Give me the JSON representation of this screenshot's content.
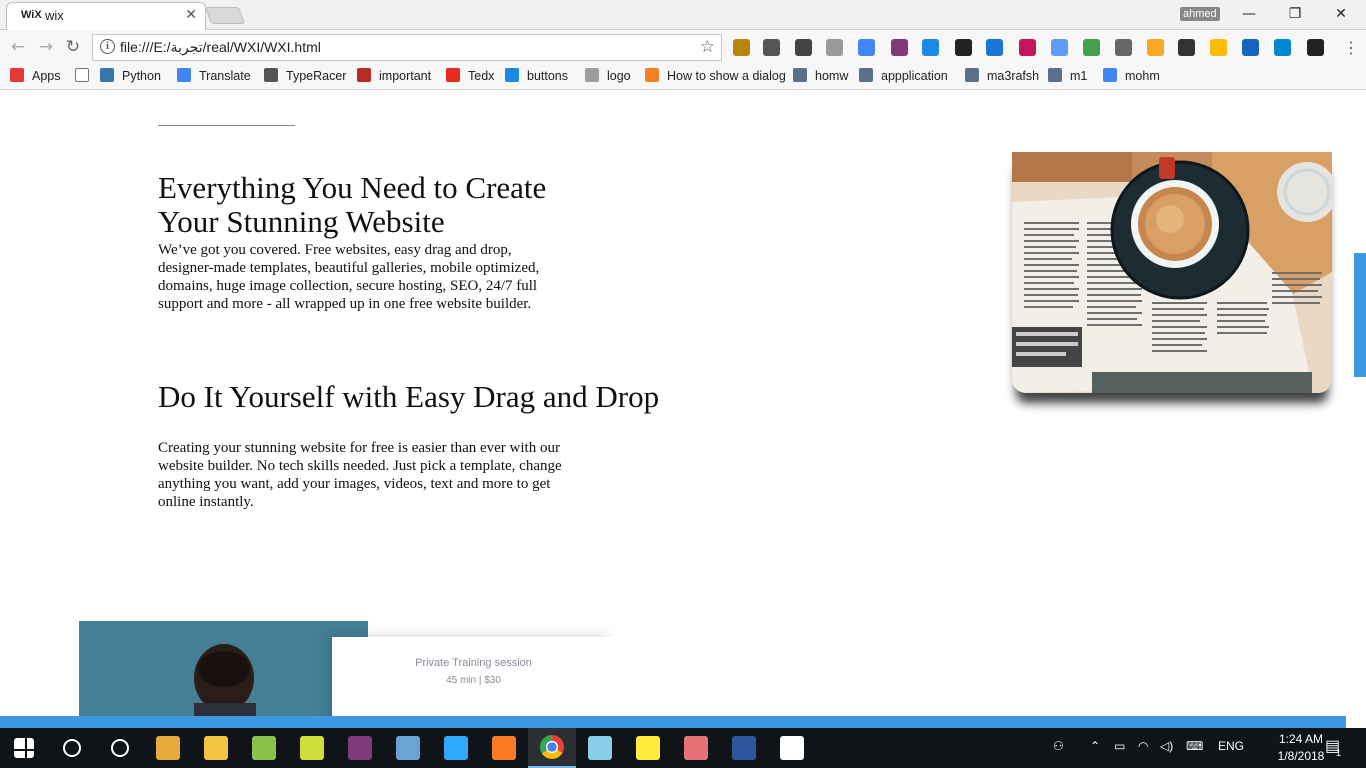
{
  "browser": {
    "tab": {
      "favicon": "WiX",
      "title": "wix",
      "close": "✕"
    },
    "profile_name": "ahmed",
    "window_controls": {
      "minimize": "—",
      "restore": "❐",
      "close": "✕"
    },
    "nav": {
      "back": "←",
      "forward": "→",
      "reload": "↻"
    },
    "address": {
      "info": "i",
      "url": "file:///E:/تجربة/real/WXI/WXI.html",
      "star": "☆"
    },
    "extensions": [
      "bookmarks-icon",
      "camera-icon",
      "lightbulb-icon",
      "dropbox-icon",
      "translate-icon",
      "onenote-icon",
      "new-badge-icon",
      "film-icon",
      "new-badge-icon",
      "paint-icon",
      "download-icon",
      "color-wheel-icon",
      "eyedropper-icon",
      "m-icon",
      "evernote-icon",
      "drive-icon",
      "window-icon",
      "s-icon",
      "shield-icon"
    ],
    "bookmarks": [
      {
        "label": "Apps",
        "icon": "apps-grid-icon",
        "color": "#e53935"
      },
      {
        "label": "",
        "icon": "page-icon",
        "color": "#ffffff"
      },
      {
        "label": "Python",
        "icon": "python-icon",
        "color": "#3776ab"
      },
      {
        "label": "Translate",
        "icon": "translate-icon",
        "color": "#4285f4"
      },
      {
        "label": "TypeRacer",
        "icon": "typeracer-icon",
        "color": "#555555"
      },
      {
        "label": "important",
        "icon": "quora-icon",
        "color": "#b92b27"
      },
      {
        "label": "Tedx",
        "icon": "tedx-icon",
        "color": "#e62b1e"
      },
      {
        "label": "buttons",
        "icon": "m-icon",
        "color": "#1e88e5"
      },
      {
        "label": "logo",
        "icon": "grid-icon",
        "color": "#9e9e9e"
      },
      {
        "label": "How to show a dialog",
        "icon": "stackoverflow-icon",
        "color": "#f48024"
      },
      {
        "label": "homw",
        "icon": "uwc-icon",
        "color": "#5b6f8a"
      },
      {
        "label": "appplication",
        "icon": "uwc-icon",
        "color": "#5b6f8a"
      },
      {
        "label": "ma3rafsh",
        "icon": "uwc-icon",
        "color": "#5b6f8a"
      },
      {
        "label": "m1",
        "icon": "uwc-icon",
        "color": "#5b6f8a"
      },
      {
        "label": "mohm",
        "icon": "docs-icon",
        "color": "#4285f4"
      }
    ]
  },
  "page": {
    "heading1": "Everything You Need to Create Your Stunning Website",
    "para1": "We’ve got you covered. Free websites, easy drag and drop, designer-made templates, beautiful galleries, mobile optimized, domains, huge image collection, secure hosting, SEO, 24/7 full support and more - all wrapped up in one free website builder.",
    "heading2": "Do It Yourself with Easy Drag and Drop",
    "para2": "Creating your stunning website for free is easier than ever with our website builder. No tech skills needed. Just pick a template, change anything you want, add your images, videos, text and more to get online instantly.",
    "card": {
      "title": "Private Training session",
      "subtitle": "45 min  |  $30"
    }
  },
  "taskbar": {
    "apps": [
      "windows-start-icon",
      "search-icon",
      "cortana-icon",
      "store-icon",
      "file-explorer-icon",
      "android-icon",
      "notepad-icon",
      "onenote-icon",
      "photos-icon",
      "photoshop-icon",
      "xampp-icon",
      "chrome-icon",
      "notes-icon",
      "sticky-notes-icon",
      "paint-icon",
      "word-icon",
      "image-icon"
    ],
    "active_app": "chrome-icon",
    "language": "ENG",
    "time": "1:24 AM",
    "date": "1/8/2018",
    "notification_count": "1"
  },
  "colors": {
    "accent": "#3d98e2",
    "taskbar": "#101418"
  }
}
